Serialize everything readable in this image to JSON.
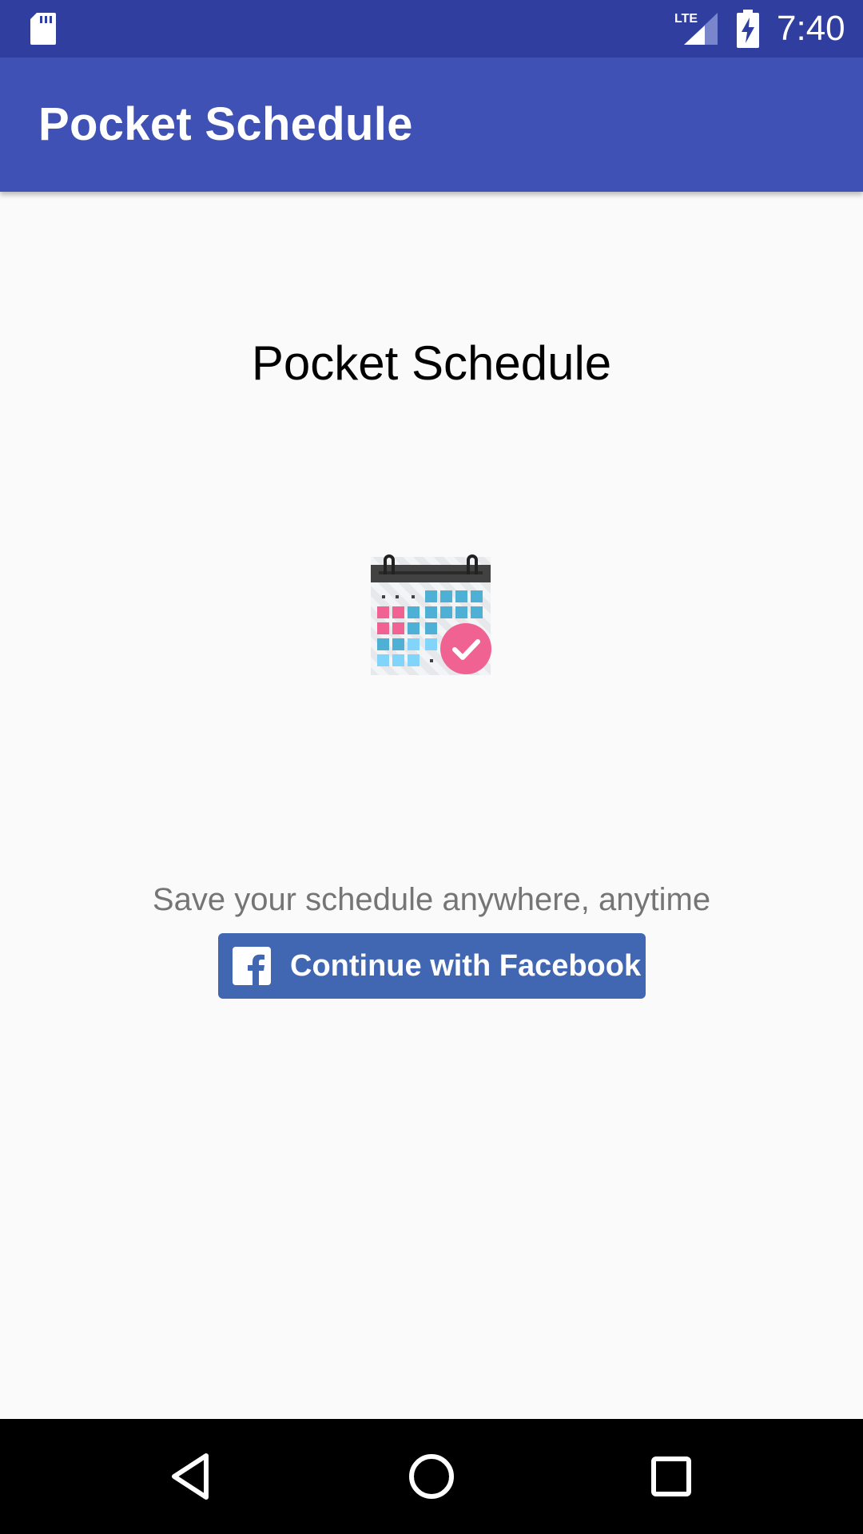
{
  "status_bar": {
    "time": "7:40",
    "network_label": "LTE",
    "icons": [
      "sd-card-icon",
      "lte-signal-icon",
      "battery-charging-icon"
    ]
  },
  "app_bar": {
    "title": "Pocket Schedule"
  },
  "main": {
    "headline": "Pocket Schedule",
    "illustration": "calendar-check-icon",
    "tagline": "Save your schedule anywhere, anytime",
    "facebook_button": {
      "label": "Continue with Facebook",
      "icon": "facebook-logo-icon",
      "color": "#4267b2"
    }
  },
  "nav_bar": {
    "buttons": [
      "back-icon",
      "home-icon",
      "recents-icon"
    ]
  },
  "colors": {
    "status_bar": "#303f9f",
    "app_bar": "#3f51b5",
    "background": "#fafafa",
    "accent_pink": "#f06292",
    "calendar_blue": "#4fb0d6"
  }
}
